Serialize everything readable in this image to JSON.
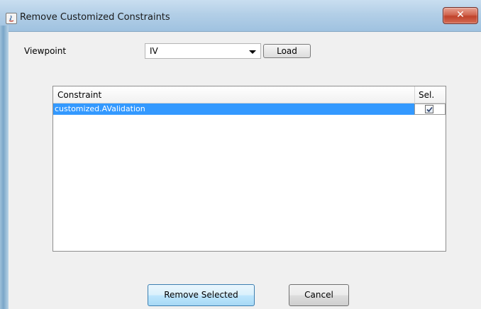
{
  "window": {
    "title": "Remove Customized Constraints",
    "icon": "java-app-icon",
    "close_icon": "close-icon",
    "close_label": "✕",
    "close_color": "#c0432b"
  },
  "form": {
    "viewpoint_label": "Viewpoint",
    "viewpoint_selected": "IV",
    "load_label": "Load"
  },
  "table": {
    "headers": [
      "Constraint",
      "Sel."
    ],
    "rows": [
      {
        "constraint": "customized.AValidation",
        "selected": true
      }
    ],
    "selection_color": "#3399ff"
  },
  "buttons": {
    "remove_selected": "Remove Selected",
    "cancel": "Cancel"
  }
}
